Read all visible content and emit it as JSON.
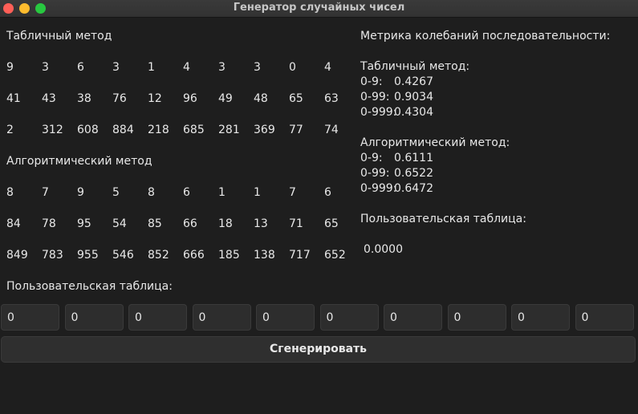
{
  "window": {
    "title": "Генератор случайных чисел"
  },
  "table_method": {
    "label": "Табличный метод",
    "rows": [
      [
        "9",
        "3",
        "6",
        "3",
        "1",
        "4",
        "3",
        "3",
        "0",
        "4"
      ],
      [
        "41",
        "43",
        "38",
        "76",
        "12",
        "96",
        "49",
        "48",
        "65",
        "63"
      ],
      [
        "2",
        "312",
        "608",
        "884",
        "218",
        "685",
        "281",
        "369",
        "77",
        "74"
      ]
    ]
  },
  "algorithmic_method": {
    "label": "Алгоритмический метод",
    "rows": [
      [
        "8",
        "7",
        "9",
        "5",
        "8",
        "6",
        "1",
        "1",
        "7",
        "6"
      ],
      [
        "84",
        "78",
        "95",
        "54",
        "85",
        "66",
        "18",
        "13",
        "71",
        "65"
      ],
      [
        "849",
        "783",
        "955",
        "546",
        "852",
        "666",
        "185",
        "138",
        "717",
        "652"
      ]
    ]
  },
  "user_table": {
    "label": "Пользовательская таблица:",
    "inputs": [
      "0",
      "0",
      "0",
      "0",
      "0",
      "0",
      "0",
      "0",
      "0",
      "0"
    ]
  },
  "metrics": {
    "heading": "Метрика колебаний последовательности:",
    "table_label": "Табличный метод:",
    "table": [
      {
        "key": "0-9:",
        "value": "0.4267"
      },
      {
        "key": "0-99:",
        "value": "0.9034"
      },
      {
        "key": "0-999:",
        "value": "0.4304"
      }
    ],
    "alg_label": "Алгоритмический метод:",
    "alg": [
      {
        "key": "0-9:",
        "value": "0.6111"
      },
      {
        "key": "0-99:",
        "value": "0.6522"
      },
      {
        "key": "0-999:",
        "value": "0.6472"
      }
    ],
    "user_label": "Пользовательская таблица:",
    "user_value": "0.0000"
  },
  "generate_button": {
    "label": "Сгенерировать"
  }
}
